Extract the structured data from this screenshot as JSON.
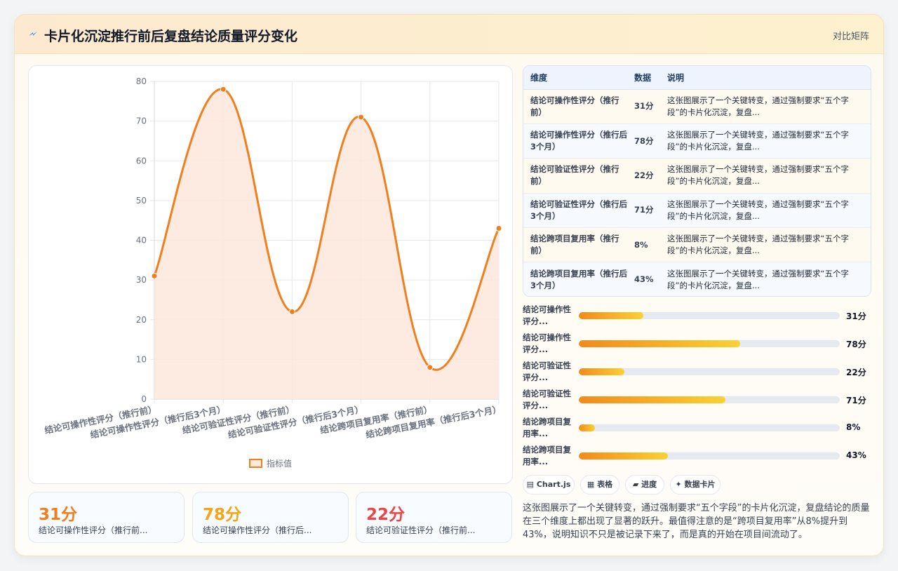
{
  "header": {
    "title": "卡片化沉淀推行前后复盘结论质量评分变化",
    "mode_label": "对比矩阵"
  },
  "colors": {
    "accent": "#f07f1e",
    "kpi_orange": "#f07f1e",
    "kpi_amber": "#f3a516",
    "kpi_red": "#ec4545",
    "area_fill": "#fde8dc"
  },
  "chart_data": {
    "type": "line",
    "categories": [
      "结论可操作性评分（推行前）",
      "结论可操作性评分（推行后3个月）",
      "结论可验证性评分（推行前）",
      "结论可验证性评分（推行后3个月）",
      "结论跨项目复用率（推行前）",
      "结论跨项目复用率（推行后3个月）"
    ],
    "series": [
      {
        "name": "指标值",
        "values": [
          31,
          78,
          22,
          71,
          8,
          43
        ]
      }
    ],
    "ylim": [
      0,
      80
    ],
    "yticks": [
      "0",
      "10",
      "20",
      "30",
      "40",
      "50",
      "60",
      "70",
      "80"
    ],
    "grid": true,
    "legend": "bottom",
    "curve": "smooth",
    "fill": true
  },
  "kpis": [
    {
      "value": "31分",
      "label": "结论可操作性评分（推行前..."
    },
    {
      "value": "78分",
      "label": "结论可操作性评分（推行后..."
    },
    {
      "value": "22分",
      "label": "结论可验证性评分（推行前..."
    }
  ],
  "table": {
    "headers": [
      "维度",
      "数据",
      "说明"
    ],
    "rows": [
      {
        "dim": "结论可操作性评分（推行前）",
        "value": "31分",
        "desc": "这张图展示了一个关键转变，通过强制要求“五个字段”的卡片化沉淀，复盘..."
      },
      {
        "dim": "结论可操作性评分（推行后3个月）",
        "value": "78分",
        "desc": "这张图展示了一个关键转变，通过强制要求“五个字段”的卡片化沉淀，复盘..."
      },
      {
        "dim": "结论可验证性评分（推行前）",
        "value": "22分",
        "desc": "这张图展示了一个关键转变，通过强制要求“五个字段”的卡片化沉淀，复盘..."
      },
      {
        "dim": "结论可验证性评分（推行后3个月）",
        "value": "71分",
        "desc": "这张图展示了一个关键转变，通过强制要求“五个字段”的卡片化沉淀，复盘..."
      },
      {
        "dim": "结论跨项目复用率（推行前）",
        "value": "8%",
        "desc": "这张图展示了一个关键转变，通过强制要求“五个字段”的卡片化沉淀，复盘..."
      },
      {
        "dim": "结论跨项目复用率（推行后3个月）",
        "value": "43%",
        "desc": "这张图展示了一个关键转变，通过强制要求“五个字段”的卡片化沉淀，复盘..."
      }
    ]
  },
  "progress": [
    {
      "label": "结论可操作性评分...",
      "value": "31分",
      "percent": 24.6
    },
    {
      "label": "结论可操作性评分...",
      "value": "78分",
      "percent": 61.9
    },
    {
      "label": "结论可验证性评分...",
      "value": "22分",
      "percent": 17.5
    },
    {
      "label": "结论可验证性评分...",
      "value": "71分",
      "percent": 56.3
    },
    {
      "label": "结论跨项目复用率...",
      "value": "8%",
      "percent": 6.3
    },
    {
      "label": "结论跨项目复用率...",
      "value": "43%",
      "percent": 34.1
    }
  ],
  "tags": [
    {
      "icon": "▤",
      "label": "Chart.js",
      "icon_name": "chart-icon"
    },
    {
      "icon": "▦",
      "label": "表格",
      "icon_name": "table-icon"
    },
    {
      "icon": "▰",
      "label": "进度",
      "icon_name": "progress-icon"
    },
    {
      "icon": "✦",
      "label": "数据卡片",
      "icon_name": "sparkle-icon"
    }
  ],
  "summary": "这张图展示了一个关键转变，通过强制要求“五个字段”的卡片化沉淀，复盘结论的质量在三个维度上都出现了显著的跃升。最值得注意的是“跨项目复用率”从8%提升到43%，说明知识不只是被记录下来了，而是真的开始在项目间流动了。"
}
